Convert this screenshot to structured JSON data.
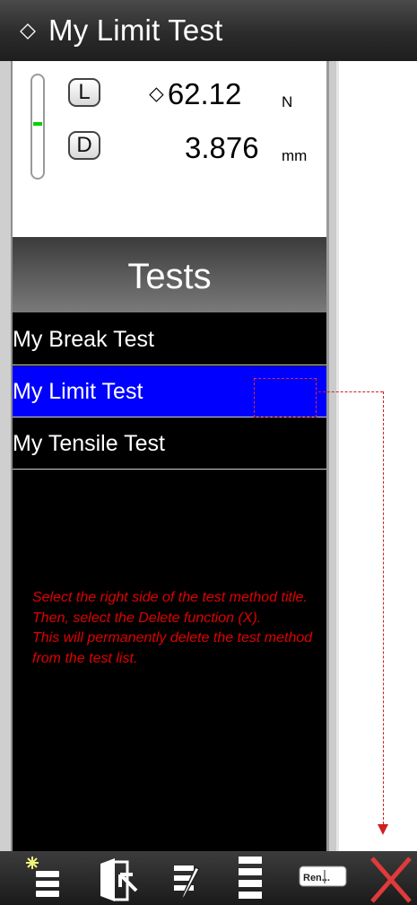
{
  "title_bar": {
    "glyph": "⬦",
    "title": "My Limit Test"
  },
  "status": {
    "meter_level_fraction": 0.55,
    "load": {
      "key": "L",
      "arrow": "⬦",
      "value": "62.12",
      "unit": "N"
    },
    "distance": {
      "key": "D",
      "value": "3.876",
      "unit": "mm"
    }
  },
  "tests": {
    "header": "Tests",
    "items": [
      {
        "label": "My Break Test",
        "selected": false
      },
      {
        "label": "My Limit Test",
        "selected": true
      },
      {
        "label": "My Tensile Test",
        "selected": false
      }
    ]
  },
  "instruction": "Select the right side of the test method title.  Then, select the Delete function (X).\nThis will permanently delete the test method from the test list.",
  "toolbar": {
    "buttons": [
      {
        "name": "new-test-button",
        "icon": "new-list-icon"
      },
      {
        "name": "import-button",
        "icon": "import-icon"
      },
      {
        "name": "edit-button",
        "icon": "edit-list-icon"
      },
      {
        "name": "list-order-button",
        "icon": "list-icon"
      },
      {
        "name": "rename-button",
        "icon": "rename-icon",
        "label": "Ren..."
      },
      {
        "name": "delete-button",
        "icon": "delete-x-icon"
      }
    ]
  },
  "colors": {
    "selection": "#0000ff",
    "instruction_text": "#e00000",
    "meter_indicator": "#00d000",
    "delete_x": "#e03a3a"
  }
}
